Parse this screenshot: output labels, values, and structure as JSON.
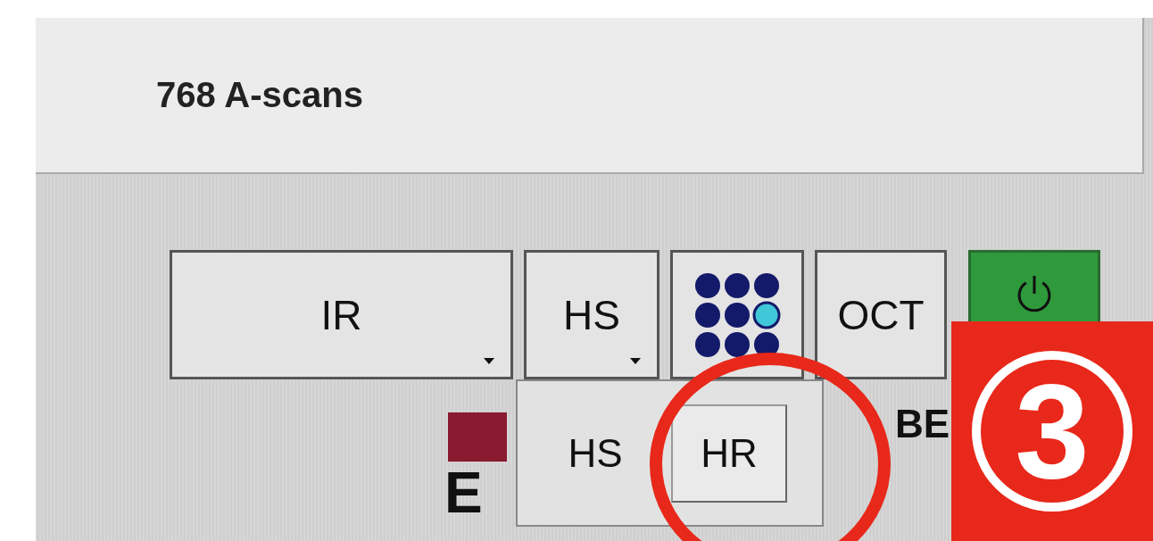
{
  "info": {
    "text": "768 A-scans"
  },
  "toolbar": [
    {
      "kind": "dropdown",
      "label": "IR"
    },
    {
      "kind": "dropdown",
      "label": "HS"
    },
    {
      "kind": "grid",
      "dots": [
        {
          "selected": false
        },
        {
          "selected": false
        },
        {
          "selected": false
        },
        {
          "selected": false
        },
        {
          "selected": false
        },
        {
          "selected": true
        },
        {
          "selected": false
        },
        {
          "selected": false
        },
        {
          "selected": false
        }
      ]
    },
    {
      "kind": "button",
      "label": "OCT"
    },
    {
      "kind": "power"
    }
  ],
  "menu": {
    "items": [
      {
        "label": "HS",
        "selected": false
      },
      {
        "label": "HR",
        "selected": true
      }
    ]
  },
  "logo": {
    "top": "BE",
    "bottom": "E"
  },
  "annotation": {
    "badge": "3"
  }
}
